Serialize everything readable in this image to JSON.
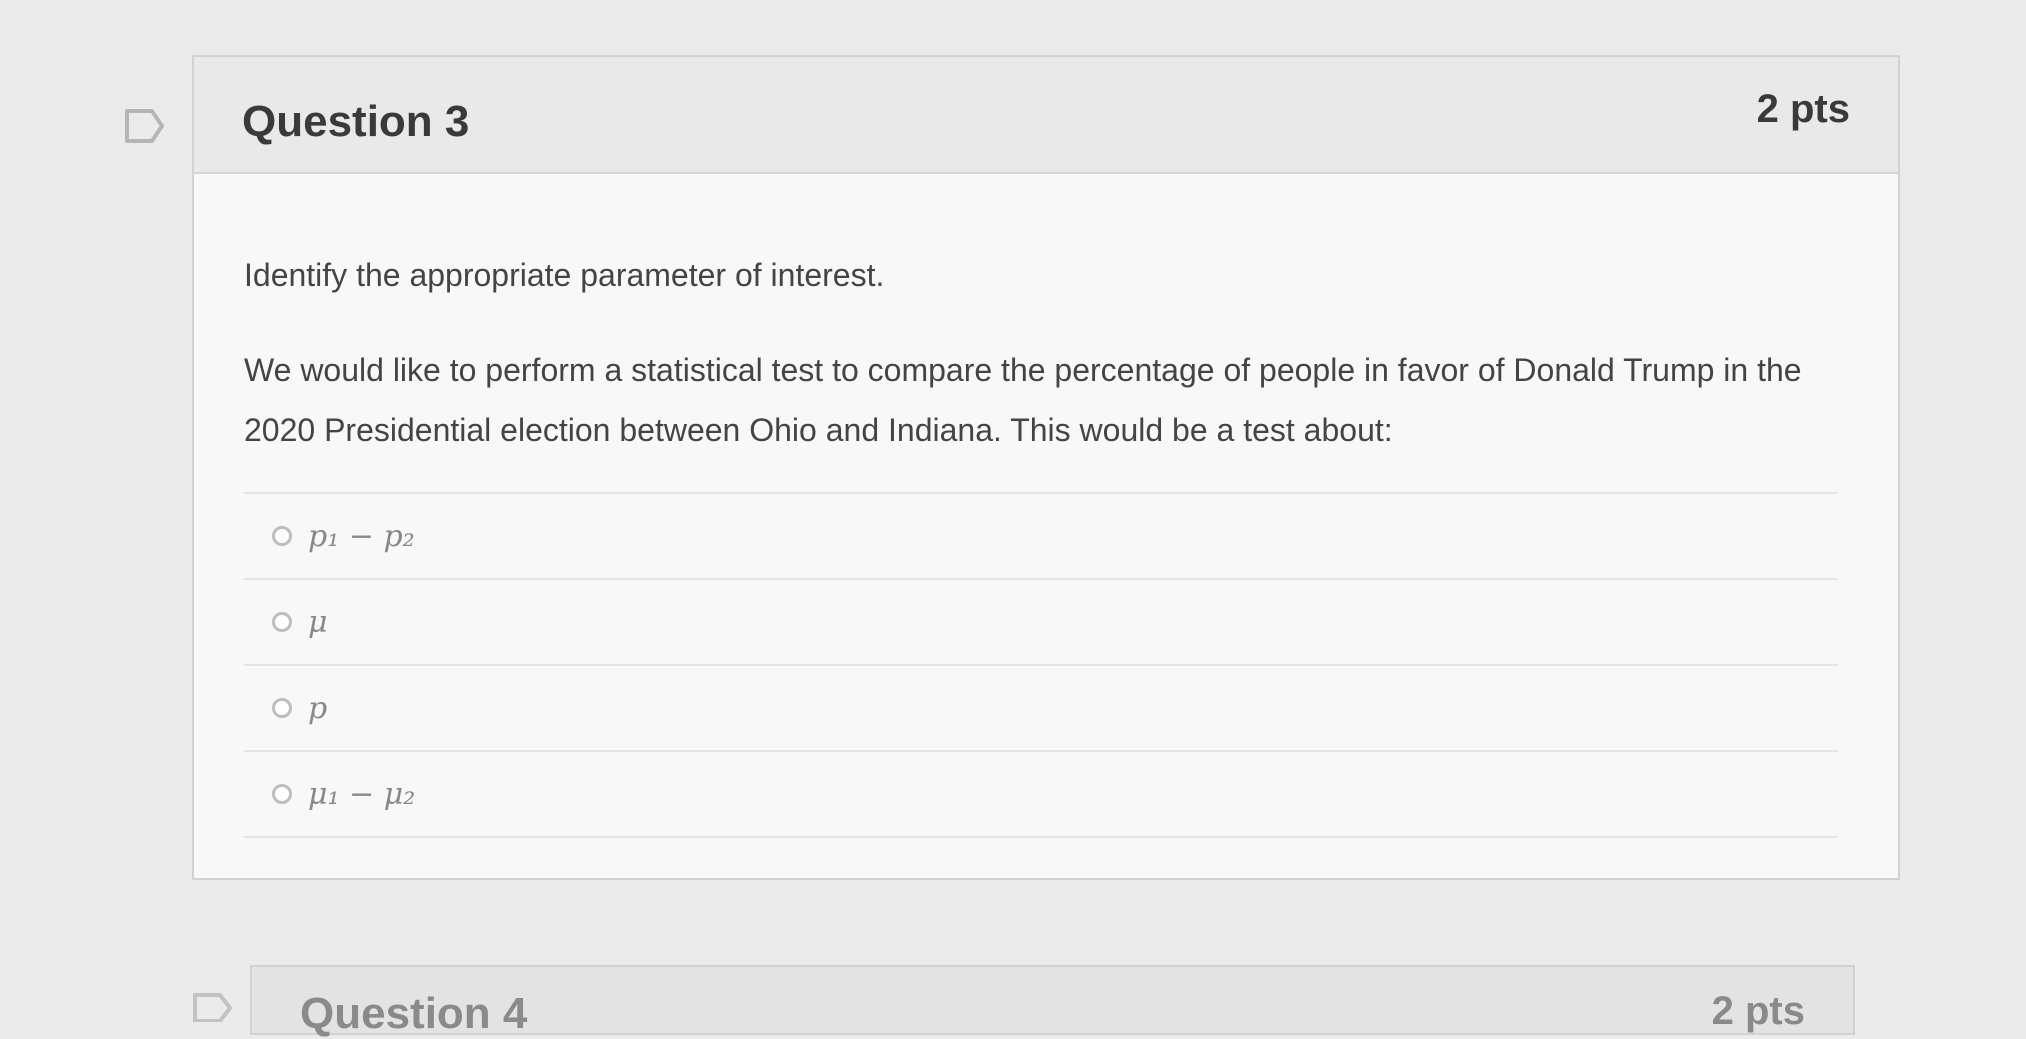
{
  "question3": {
    "title": "Question 3",
    "points": "2 pts",
    "instruction": "Identify the appropriate parameter of interest.",
    "text": "We would like to perform a statistical test to compare the percentage of people in favor of Donald Trump in the 2020 Presidential election between Ohio and Indiana. This would be a test about:",
    "options": [
      {
        "label": "p₁ − p₂"
      },
      {
        "label": "μ"
      },
      {
        "label": "p"
      },
      {
        "label": "μ₁ − μ₂"
      }
    ]
  },
  "question4": {
    "title": "Question 4",
    "points": "2 pts"
  },
  "icons": {
    "flag": "flag-icon",
    "radio": "radio-button-icon"
  },
  "colors": {
    "background": "#ebebeb",
    "card": "#f8f8f8",
    "header": "#e9e9e9",
    "text": "#444444"
  }
}
